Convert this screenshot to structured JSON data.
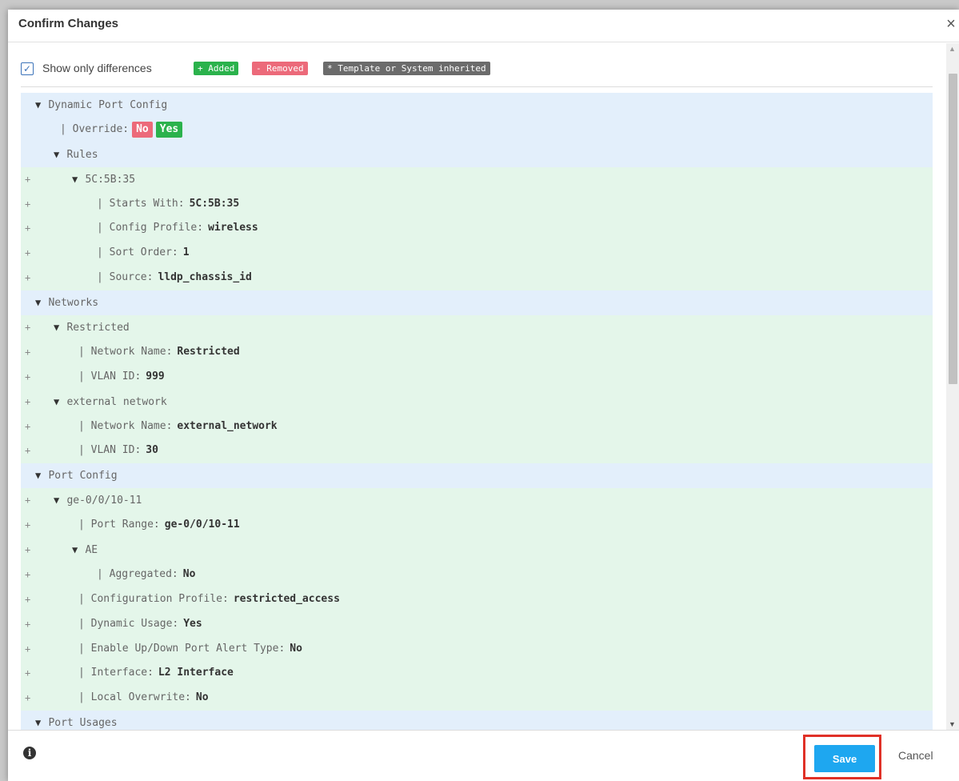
{
  "dialog": {
    "title": "Confirm Changes",
    "close_glyph": "×"
  },
  "legend": {
    "checkbox_checked": true,
    "show_only_label": "Show only differences",
    "added_label": "+ Added",
    "removed_label": "- Removed",
    "template_label": "* Template or System inherited"
  },
  "diff_rows": [
    {
      "type": "ctx",
      "mark": "",
      "indent": 1,
      "tri": true,
      "label": "Dynamic Port Config",
      "value": ""
    },
    {
      "type": "ctx",
      "mark": "",
      "indent": 2,
      "tri": false,
      "label": "| Override:",
      "value": "",
      "pills": [
        "No",
        "Yes"
      ]
    },
    {
      "type": "ctx",
      "mark": "",
      "indent": 2,
      "tri": true,
      "label": "Rules",
      "value": ""
    },
    {
      "type": "add",
      "mark": "+",
      "indent": 3,
      "tri": true,
      "label": "5C:5B:35",
      "value": ""
    },
    {
      "type": "add",
      "mark": "+",
      "indent": 4,
      "tri": false,
      "label": "| Starts With:",
      "value": "5C:5B:35"
    },
    {
      "type": "add",
      "mark": "+",
      "indent": 4,
      "tri": false,
      "label": "| Config Profile:",
      "value": "wireless"
    },
    {
      "type": "add",
      "mark": "+",
      "indent": 4,
      "tri": false,
      "label": "| Sort Order:",
      "value": "1"
    },
    {
      "type": "add",
      "mark": "+",
      "indent": 4,
      "tri": false,
      "label": "| Source:",
      "value": "lldp_chassis_id"
    },
    {
      "type": "ctx",
      "mark": "",
      "indent": 1,
      "tri": true,
      "label": "Networks",
      "value": ""
    },
    {
      "type": "add",
      "mark": "+",
      "indent": 2,
      "tri": true,
      "label": "Restricted",
      "value": ""
    },
    {
      "type": "add",
      "mark": "+",
      "indent": 3,
      "tri": false,
      "label": "| Network Name:",
      "value": "Restricted"
    },
    {
      "type": "add",
      "mark": "+",
      "indent": 3,
      "tri": false,
      "label": "| VLAN ID:",
      "value": "999"
    },
    {
      "type": "add",
      "mark": "+",
      "indent": 2,
      "tri": true,
      "label": "external network",
      "value": ""
    },
    {
      "type": "add",
      "mark": "+",
      "indent": 3,
      "tri": false,
      "label": "| Network Name:",
      "value": "external_network"
    },
    {
      "type": "add",
      "mark": "+",
      "indent": 3,
      "tri": false,
      "label": "| VLAN ID:",
      "value": "30"
    },
    {
      "type": "ctx",
      "mark": "",
      "indent": 1,
      "tri": true,
      "label": "Port Config",
      "value": ""
    },
    {
      "type": "add",
      "mark": "+",
      "indent": 2,
      "tri": true,
      "label": "ge-0/0/10-11",
      "value": ""
    },
    {
      "type": "add",
      "mark": "+",
      "indent": 3,
      "tri": false,
      "label": "| Port Range:",
      "value": "ge-0/0/10-11"
    },
    {
      "type": "add",
      "mark": "+",
      "indent": 3,
      "tri": true,
      "label": "AE",
      "value": ""
    },
    {
      "type": "add",
      "mark": "+",
      "indent": 4,
      "tri": false,
      "label": "| Aggregated:",
      "value": "No"
    },
    {
      "type": "add",
      "mark": "+",
      "indent": 3,
      "tri": false,
      "label": "| Configuration Profile:",
      "value": "restricted_access"
    },
    {
      "type": "add",
      "mark": "+",
      "indent": 3,
      "tri": false,
      "label": "| Dynamic Usage:",
      "value": "Yes"
    },
    {
      "type": "add",
      "mark": "+",
      "indent": 3,
      "tri": false,
      "label": "| Enable Up/Down Port Alert Type:",
      "value": "No"
    },
    {
      "type": "add",
      "mark": "+",
      "indent": 3,
      "tri": false,
      "label": "| Interface:",
      "value": "L2 Interface"
    },
    {
      "type": "add",
      "mark": "+",
      "indent": 3,
      "tri": false,
      "label": "| Local Overwrite:",
      "value": "No"
    },
    {
      "type": "ctx",
      "mark": "",
      "indent": 1,
      "tri": true,
      "label": "Port Usages",
      "value": ""
    }
  ],
  "footer": {
    "info_glyph": "i",
    "save_label": "Save",
    "cancel_label": "Cancel"
  },
  "colors": {
    "added": "#2bb24c",
    "removed": "#ec6a7a",
    "template": "#6b6b6b",
    "save": "#1ea7f0",
    "highlight": "#e03127"
  }
}
